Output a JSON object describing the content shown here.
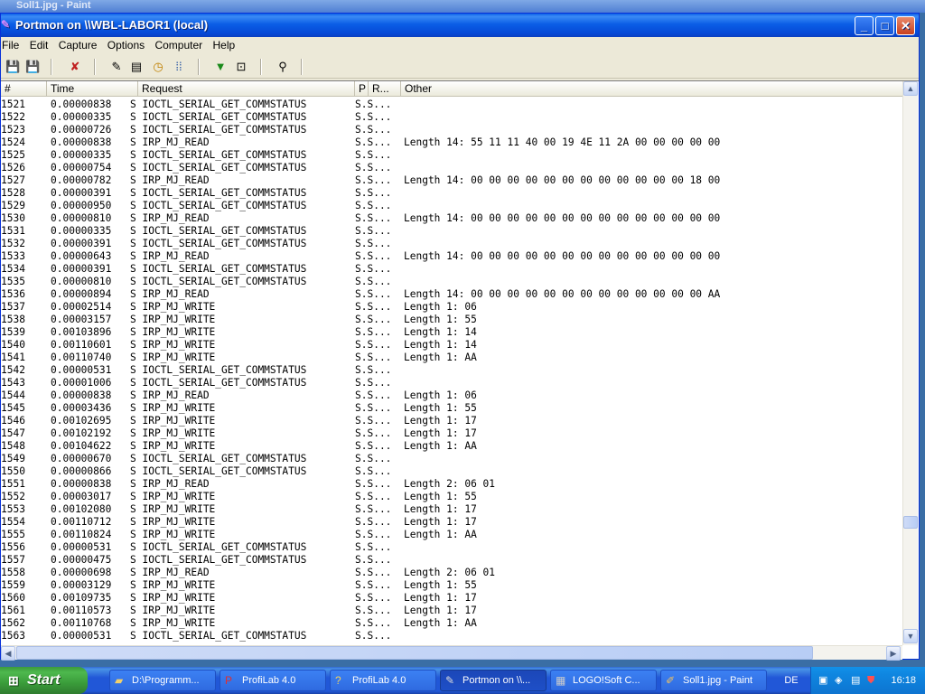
{
  "background_window": {
    "title": "Soll1.jpg - Paint"
  },
  "window": {
    "title": "Portmon on \\\\WBL-LABOR1 (local)",
    "controls": {
      "minimize": "_",
      "maximize": "□",
      "close": "✕"
    }
  },
  "menu": [
    "File",
    "Edit",
    "Capture",
    "Options",
    "Computer",
    "Help"
  ],
  "toolbar": {
    "icons": [
      "save-icon",
      "save-as-icon",
      "clear-icon",
      "autoscroll-icon",
      "filter-icon",
      "timer-icon",
      "connect-icon",
      "highlight-icon",
      "properties-icon",
      "find-icon"
    ]
  },
  "columns": [
    "#",
    "Time",
    "Request",
    "P",
    "R...",
    "Other"
  ],
  "rows": [
    {
      "num": "1521",
      "time": "0.00000838",
      "req": "S IOCTL_SERIAL_GET_COMMSTATUS",
      "pr": "S.S...",
      "other": ""
    },
    {
      "num": "1522",
      "time": "0.00000335",
      "req": "S IOCTL_SERIAL_GET_COMMSTATUS",
      "pr": "S.S...",
      "other": ""
    },
    {
      "num": "1523",
      "time": "0.00000726",
      "req": "S IOCTL_SERIAL_GET_COMMSTATUS",
      "pr": "S.S...",
      "other": ""
    },
    {
      "num": "1524",
      "time": "0.00000838",
      "req": "S IRP_MJ_READ",
      "pr": "S.S...",
      "other": "Length 14: 55 11 11 40 00 19 4E 11 2A 00 00 00 00 00"
    },
    {
      "num": "1525",
      "time": "0.00000335",
      "req": "S IOCTL_SERIAL_GET_COMMSTATUS",
      "pr": "S.S...",
      "other": ""
    },
    {
      "num": "1526",
      "time": "0.00000754",
      "req": "S IOCTL_SERIAL_GET_COMMSTATUS",
      "pr": "S.S...",
      "other": ""
    },
    {
      "num": "1527",
      "time": "0.00000782",
      "req": "S IRP_MJ_READ",
      "pr": "S.S...",
      "other": "Length 14: 00 00 00 00 00 00 00 00 00 00 00 00 18 00"
    },
    {
      "num": "1528",
      "time": "0.00000391",
      "req": "S IOCTL_SERIAL_GET_COMMSTATUS",
      "pr": "S.S...",
      "other": ""
    },
    {
      "num": "1529",
      "time": "0.00000950",
      "req": "S IOCTL_SERIAL_GET_COMMSTATUS",
      "pr": "S.S...",
      "other": ""
    },
    {
      "num": "1530",
      "time": "0.00000810",
      "req": "S IRP_MJ_READ",
      "pr": "S.S...",
      "other": "Length 14: 00 00 00 00 00 00 00 00 00 00 00 00 00 00"
    },
    {
      "num": "1531",
      "time": "0.00000335",
      "req": "S IOCTL_SERIAL_GET_COMMSTATUS",
      "pr": "S.S...",
      "other": ""
    },
    {
      "num": "1532",
      "time": "0.00000391",
      "req": "S IOCTL_SERIAL_GET_COMMSTATUS",
      "pr": "S.S...",
      "other": ""
    },
    {
      "num": "1533",
      "time": "0.00000643",
      "req": "S IRP_MJ_READ",
      "pr": "S.S...",
      "other": "Length 14: 00 00 00 00 00 00 00 00 00 00 00 00 00 00"
    },
    {
      "num": "1534",
      "time": "0.00000391",
      "req": "S IOCTL_SERIAL_GET_COMMSTATUS",
      "pr": "S.S...",
      "other": ""
    },
    {
      "num": "1535",
      "time": "0.00000810",
      "req": "S IOCTL_SERIAL_GET_COMMSTATUS",
      "pr": "S.S...",
      "other": ""
    },
    {
      "num": "1536",
      "time": "0.00000894",
      "req": "S IRP_MJ_READ",
      "pr": "S.S...",
      "other": "Length 14: 00 00 00 00 00 00 00 00 00 00 00 00 00 AA"
    },
    {
      "num": "1537",
      "time": "0.00002514",
      "req": "S IRP_MJ_WRITE",
      "pr": "S.S...",
      "other": "Length 1: 06"
    },
    {
      "num": "1538",
      "time": "0.00003157",
      "req": "S IRP_MJ_WRITE",
      "pr": "S.S...",
      "other": "Length 1: 55"
    },
    {
      "num": "1539",
      "time": "0.00103896",
      "req": "S IRP_MJ_WRITE",
      "pr": "S.S...",
      "other": "Length 1: 14"
    },
    {
      "num": "1540",
      "time": "0.00110601",
      "req": "S IRP_MJ_WRITE",
      "pr": "S.S...",
      "other": "Length 1: 14"
    },
    {
      "num": "1541",
      "time": "0.00110740",
      "req": "S IRP_MJ_WRITE",
      "pr": "S.S...",
      "other": "Length 1: AA"
    },
    {
      "num": "1542",
      "time": "0.00000531",
      "req": "S IOCTL_SERIAL_GET_COMMSTATUS",
      "pr": "S.S...",
      "other": ""
    },
    {
      "num": "1543",
      "time": "0.00001006",
      "req": "S IOCTL_SERIAL_GET_COMMSTATUS",
      "pr": "S.S...",
      "other": ""
    },
    {
      "num": "1544",
      "time": "0.00000838",
      "req": "S IRP_MJ_READ",
      "pr": "S.S...",
      "other": "Length 1: 06"
    },
    {
      "num": "1545",
      "time": "0.00003436",
      "req": "S IRP_MJ_WRITE",
      "pr": "S.S...",
      "other": "Length 1: 55"
    },
    {
      "num": "1546",
      "time": "0.00102695",
      "req": "S IRP_MJ_WRITE",
      "pr": "S.S...",
      "other": "Length 1: 17"
    },
    {
      "num": "1547",
      "time": "0.00102192",
      "req": "S IRP_MJ_WRITE",
      "pr": "S.S...",
      "other": "Length 1: 17"
    },
    {
      "num": "1548",
      "time": "0.00104622",
      "req": "S IRP_MJ_WRITE",
      "pr": "S.S...",
      "other": "Length 1: AA"
    },
    {
      "num": "1549",
      "time": "0.00000670",
      "req": "S IOCTL_SERIAL_GET_COMMSTATUS",
      "pr": "S.S...",
      "other": ""
    },
    {
      "num": "1550",
      "time": "0.00000866",
      "req": "S IOCTL_SERIAL_GET_COMMSTATUS",
      "pr": "S.S...",
      "other": ""
    },
    {
      "num": "1551",
      "time": "0.00000838",
      "req": "S IRP_MJ_READ",
      "pr": "S.S...",
      "other": "Length 2: 06 01"
    },
    {
      "num": "1552",
      "time": "0.00003017",
      "req": "S IRP_MJ_WRITE",
      "pr": "S.S...",
      "other": "Length 1: 55"
    },
    {
      "num": "1553",
      "time": "0.00102080",
      "req": "S IRP_MJ_WRITE",
      "pr": "S.S...",
      "other": "Length 1: 17"
    },
    {
      "num": "1554",
      "time": "0.00110712",
      "req": "S IRP_MJ_WRITE",
      "pr": "S.S...",
      "other": "Length 1: 17"
    },
    {
      "num": "1555",
      "time": "0.00110824",
      "req": "S IRP_MJ_WRITE",
      "pr": "S.S...",
      "other": "Length 1: AA"
    },
    {
      "num": "1556",
      "time": "0.00000531",
      "req": "S IOCTL_SERIAL_GET_COMMSTATUS",
      "pr": "S.S...",
      "other": ""
    },
    {
      "num": "1557",
      "time": "0.00000475",
      "req": "S IOCTL_SERIAL_GET_COMMSTATUS",
      "pr": "S.S...",
      "other": ""
    },
    {
      "num": "1558",
      "time": "0.00000698",
      "req": "S IRP_MJ_READ",
      "pr": "S.S...",
      "other": "Length 2: 06 01"
    },
    {
      "num": "1559",
      "time": "0.00003129",
      "req": "S IRP_MJ_WRITE",
      "pr": "S.S...",
      "other": "Length 1: 55"
    },
    {
      "num": "1560",
      "time": "0.00109735",
      "req": "S IRP_MJ_WRITE",
      "pr": "S.S...",
      "other": "Length 1: 17"
    },
    {
      "num": "1561",
      "time": "0.00110573",
      "req": "S IRP_MJ_WRITE",
      "pr": "S.S...",
      "other": "Length 1: 17"
    },
    {
      "num": "1562",
      "time": "0.00110768",
      "req": "S IRP_MJ_WRITE",
      "pr": "S.S...",
      "other": "Length 1: AA"
    },
    {
      "num": "1563",
      "time": "0.00000531",
      "req": "S IOCTL_SERIAL_GET_COMMSTATUS",
      "pr": "S.S...",
      "other": ""
    }
  ],
  "taskbar": {
    "start_label": "Start",
    "tasks": [
      {
        "label": "D:\\Programm...",
        "icon": "folder-icon"
      },
      {
        "label": "ProfiLab 4.0",
        "icon": "profilab-icon"
      },
      {
        "label": "ProfiLab 4.0",
        "icon": "profilab-icon"
      },
      {
        "label": "Portmon on \\\\...",
        "icon": "portmon-icon",
        "active": true
      },
      {
        "label": "LOGO!Soft C...",
        "icon": "logosoft-icon"
      },
      {
        "label": "Soll1.jpg - Paint",
        "icon": "paint-icon"
      }
    ],
    "language": "DE",
    "clock": "16:18"
  }
}
